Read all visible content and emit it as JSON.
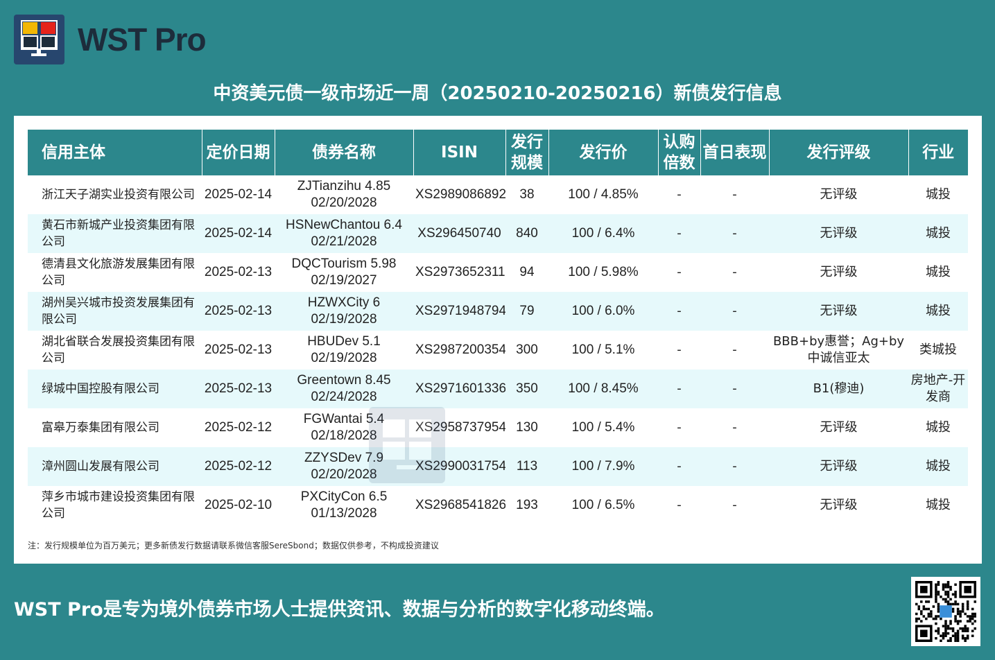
{
  "brand": {
    "name": "WST Pro",
    "colors": {
      "background": "#2c878c",
      "logo_bg": "#27466e",
      "yellow": "#f2b705",
      "red": "#e5231b",
      "row_alt": "#e6f9fb"
    }
  },
  "title": "中资美元债一级市场近一周（20250210-20250216）新债发行信息",
  "table": {
    "headers": {
      "entity": "信用主体",
      "date": "定价日期",
      "bond": "债券名称",
      "isin": "ISIN",
      "size": "发行规模",
      "price": "发行价",
      "subscription": "认购倍数",
      "day1": "首日表现",
      "rating": "发行评级",
      "industry": "行业"
    },
    "rows": [
      {
        "entity": "浙江天子湖实业投资有限公司",
        "date": "2025-02-14",
        "bond": "ZJTianzihu 4.85 02/20/2028",
        "isin": "XS2989086892",
        "size": "38",
        "price": "100 / 4.85%",
        "subscription": "-",
        "day1": "-",
        "rating": "无评级",
        "industry": "城投"
      },
      {
        "entity": "黄石市新城产业投资集团有限公司",
        "date": "2025-02-14",
        "bond": "HSNewChantou 6.4 02/21/2028",
        "isin": "XS296450740",
        "size": "840",
        "price": "100 / 6.4%",
        "subscription": "-",
        "day1": "-",
        "rating": "无评级",
        "industry": "城投"
      },
      {
        "entity": "德清县文化旅游发展集团有限公司",
        "date": "2025-02-13",
        "bond": "DQCTourism 5.98 02/19/2027",
        "isin": "XS2973652311",
        "size": "94",
        "price": "100 / 5.98%",
        "subscription": "-",
        "day1": "-",
        "rating": "无评级",
        "industry": "城投"
      },
      {
        "entity": "湖州吴兴城市投资发展集团有限公司",
        "date": "2025-02-13",
        "bond": "HZWXCity 6 02/19/2028",
        "isin": "XS2971948794",
        "size": "79",
        "price": "100 / 6.0%",
        "subscription": "-",
        "day1": "-",
        "rating": "无评级",
        "industry": "城投"
      },
      {
        "entity": "湖北省联合发展投资集团有限公司",
        "date": "2025-02-13",
        "bond": "HBUDev 5.1 02/19/2028",
        "isin": "XS2987200354",
        "size": "300",
        "price": "100 / 5.1%",
        "subscription": "-",
        "day1": "-",
        "rating": "BBB+by惠誉；Ag+by中诚信亚太",
        "industry": "类城投"
      },
      {
        "entity": "绿城中国控股有限公司",
        "date": "2025-02-13",
        "bond": "Greentown 8.45 02/24/2028",
        "isin": "XS2971601336",
        "size": "350",
        "price": "100 / 8.45%",
        "subscription": "-",
        "day1": "-",
        "rating": "B1(穆迪)",
        "industry": "房地产-开发商"
      },
      {
        "entity": "富皋万泰集团有限公司",
        "date": "2025-02-12",
        "bond": "FGWantai 5.4 02/18/2028",
        "isin": "XS2958737954",
        "size": "130",
        "price": "100 / 5.4%",
        "subscription": "-",
        "day1": "-",
        "rating": "无评级",
        "industry": "城投"
      },
      {
        "entity": "漳州圆山发展有限公司",
        "date": "2025-02-12",
        "bond": "ZZYSDev 7.9 02/20/2028",
        "isin": "XS2990031754",
        "size": "113",
        "price": "100 / 7.9%",
        "subscription": "-",
        "day1": "-",
        "rating": "无评级",
        "industry": "城投"
      },
      {
        "entity": "萍乡市城市建设投资集团有限公司",
        "date": "2025-02-10",
        "bond": "PXCityCon 6.5 01/13/2028",
        "isin": "XS2968541826",
        "size": "193",
        "price": "100 / 6.5%",
        "subscription": "-",
        "day1": "-",
        "rating": "无评级",
        "industry": "城投"
      }
    ]
  },
  "note": "注：发行规模单位为百万美元；更多新债发行数据请联系微信客服SereSbond；数据仅供参考，不构成投资建议",
  "footer": "WST Pro是专为境外债券市场人士提供资讯、数据与分析的数字化移动终端。",
  "icons": {
    "logo": "wst-logo-icon",
    "qr": "qr-code-icon",
    "watermark": "wst-watermark-icon"
  }
}
